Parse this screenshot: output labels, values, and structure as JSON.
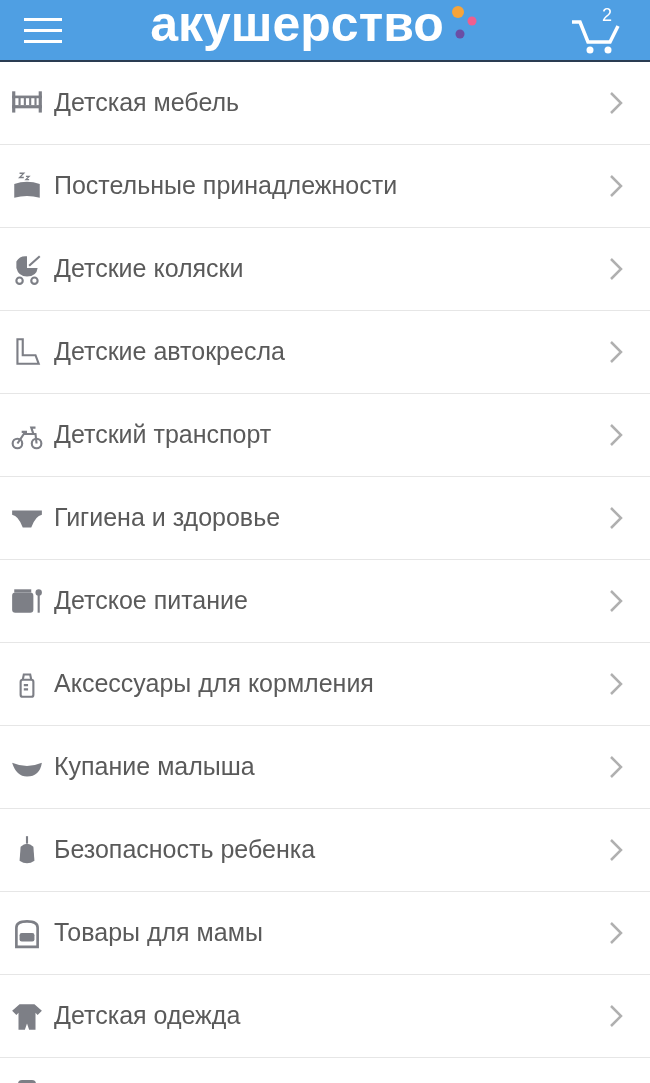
{
  "header": {
    "logo": "акушерство",
    "cart_count": "2"
  },
  "categories": [
    {
      "label": "Детская мебель"
    },
    {
      "label": "Постельные принадлежности"
    },
    {
      "label": "Детские коляски"
    },
    {
      "label": "Детские автокресла"
    },
    {
      "label": "Детский транспорт"
    },
    {
      "label": "Гигиена и здоровье"
    },
    {
      "label": "Детское питание"
    },
    {
      "label": "Аксессуары для кормления"
    },
    {
      "label": "Купание малыша"
    },
    {
      "label": "Безопасность ребенка"
    },
    {
      "label": "Товары для мамы"
    },
    {
      "label": "Детская одежда"
    }
  ]
}
